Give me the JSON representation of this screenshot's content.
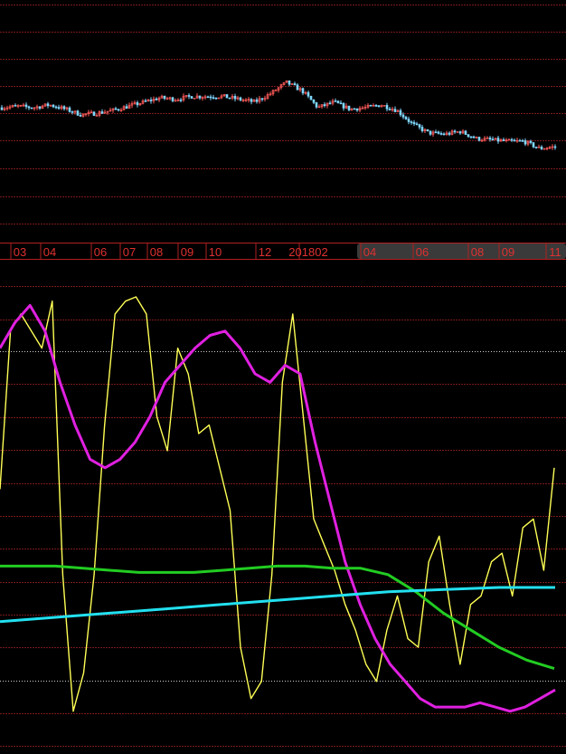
{
  "colors": {
    "background": "#000000",
    "grid": "#7a1a1a",
    "dotted_grid": "#cfcfcf",
    "axis_text": "#e03030",
    "axis_line": "#b02020",
    "range_highlight": "#3a3a3a",
    "candle_up": "#ff5a5a",
    "candle_down": "#7fd8ff",
    "yellow": "#ffff55",
    "magenta": "#e020e0",
    "green": "#22cc22",
    "cyan": "#22e0f0"
  },
  "chart_data": [
    {
      "type": "candlestick",
      "title": "",
      "x_tick_labels": [
        "03",
        "04",
        "06",
        "07",
        "08",
        "09",
        "10",
        "12",
        "201802",
        "04",
        "06",
        "08",
        "09",
        "11"
      ],
      "selected_range_labels": [
        "04",
        "06",
        "08",
        "09",
        "11"
      ],
      "price_trend": [
        0.62,
        0.63,
        0.62,
        0.64,
        0.61,
        0.57,
        0.58,
        0.6,
        0.63,
        0.66,
        0.69,
        0.68,
        0.7,
        0.7,
        0.7,
        0.68,
        0.66,
        0.72,
        0.8,
        0.74,
        0.62,
        0.66,
        0.61,
        0.62,
        0.64,
        0.6,
        0.5,
        0.44,
        0.43,
        0.45,
        0.4,
        0.39,
        0.38,
        0.38,
        0.33,
        0.34
      ]
    },
    {
      "type": "line",
      "title": "",
      "series": [
        {
          "color": "yellow",
          "values": [
            55,
            92,
            96,
            92,
            88,
            99,
            35,
            3,
            12,
            35,
            70,
            96,
            99,
            100,
            96,
            72,
            64,
            88,
            82,
            68,
            70,
            60,
            50,
            18,
            6,
            10,
            35,
            80,
            96,
            72,
            48,
            42,
            36,
            28,
            22,
            14,
            10,
            22,
            30,
            20,
            18,
            38,
            44,
            28,
            14,
            28,
            30,
            38,
            40,
            30,
            46,
            48,
            36,
            60
          ]
        },
        {
          "color": "magenta",
          "values": [
            88,
            94,
            98,
            92,
            80,
            70,
            62,
            60,
            62,
            66,
            72,
            80,
            84,
            88,
            91,
            92,
            88,
            82,
            80,
            84,
            82,
            66,
            52,
            38,
            28,
            20,
            14,
            10,
            6,
            4,
            4,
            4,
            5,
            4,
            3,
            4,
            6,
            8
          ]
        },
        {
          "color": "green",
          "values": [
            37,
            37,
            37,
            36.5,
            36,
            35.5,
            35.5,
            35.5,
            36,
            36.5,
            37,
            37,
            36.5,
            36.5,
            35,
            31,
            26,
            22,
            18,
            15,
            13
          ]
        },
        {
          "color": "cyan",
          "values": [
            24,
            25,
            26,
            27,
            28,
            29,
            30,
            31,
            31.5,
            32,
            32
          ]
        }
      ]
    }
  ]
}
